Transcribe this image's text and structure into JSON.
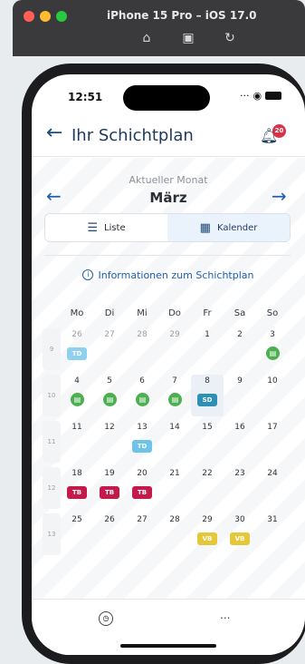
{
  "simulator": {
    "title": "iPhone 15 Pro – iOS 17.0",
    "icons": [
      "home-icon",
      "screenshot-icon",
      "rotate-icon"
    ]
  },
  "status_bar": {
    "time": "12:51",
    "icons": [
      "dots-icon",
      "wifi-icon",
      "battery-icon"
    ]
  },
  "header": {
    "title": "Ihr Schichtplan",
    "notification_count": "20"
  },
  "month": {
    "label": "Aktueller Monat",
    "name": "März"
  },
  "view_toggle": {
    "list_label": "Liste",
    "calendar_label": "Kalender",
    "active": "Kalender"
  },
  "info_link": "Informationen zum Schichtplan",
  "weekdays": [
    "Mo",
    "Di",
    "Mi",
    "Do",
    "Fr",
    "Sa",
    "So"
  ],
  "weeks": [
    {
      "kw": "9",
      "days": [
        {
          "n": "26",
          "muted": true,
          "shift": "TD",
          "color": "#8fd0ef"
        },
        {
          "n": "27",
          "muted": true
        },
        {
          "n": "28",
          "muted": true
        },
        {
          "n": "29",
          "muted": true
        },
        {
          "n": "1"
        },
        {
          "n": "2"
        },
        {
          "n": "3",
          "icon": "suitcase-icon"
        }
      ]
    },
    {
      "kw": "10",
      "days": [
        {
          "n": "4",
          "icon": "suitcase-icon"
        },
        {
          "n": "5",
          "icon": "suitcase-icon"
        },
        {
          "n": "6",
          "icon": "suitcase-icon"
        },
        {
          "n": "7",
          "icon": "suitcase-icon"
        },
        {
          "n": "8",
          "today": true,
          "shift": "SD",
          "color": "#2d8fb3"
        },
        {
          "n": "9"
        },
        {
          "n": "10"
        }
      ]
    },
    {
      "kw": "11",
      "days": [
        {
          "n": "11"
        },
        {
          "n": "12"
        },
        {
          "n": "13",
          "shift": "TD",
          "color": "#6ec4e8"
        },
        {
          "n": "14"
        },
        {
          "n": "15"
        },
        {
          "n": "16"
        },
        {
          "n": "17"
        }
      ]
    },
    {
      "kw": "12",
      "days": [
        {
          "n": "18",
          "shift": "TB",
          "color": "#c5194b"
        },
        {
          "n": "19",
          "shift": "TB",
          "color": "#c5194b"
        },
        {
          "n": "20",
          "shift": "TB",
          "color": "#c5194b"
        },
        {
          "n": "21"
        },
        {
          "n": "22"
        },
        {
          "n": "23"
        },
        {
          "n": "24"
        }
      ]
    },
    {
      "kw": "13",
      "days": [
        {
          "n": "25"
        },
        {
          "n": "26"
        },
        {
          "n": "27"
        },
        {
          "n": "28"
        },
        {
          "n": "29",
          "shift": "VB",
          "color": "#e5c73a"
        },
        {
          "n": "30",
          "shift": "VB",
          "color": "#e5c73a"
        },
        {
          "n": "31"
        }
      ]
    }
  ],
  "footer": {
    "tabs": [
      "clock-icon",
      "more-icon"
    ],
    "more_label": "..."
  },
  "colors": {
    "accent": "#1f5fb0",
    "badge": "#d8334a",
    "vacation": "#4caf50"
  }
}
